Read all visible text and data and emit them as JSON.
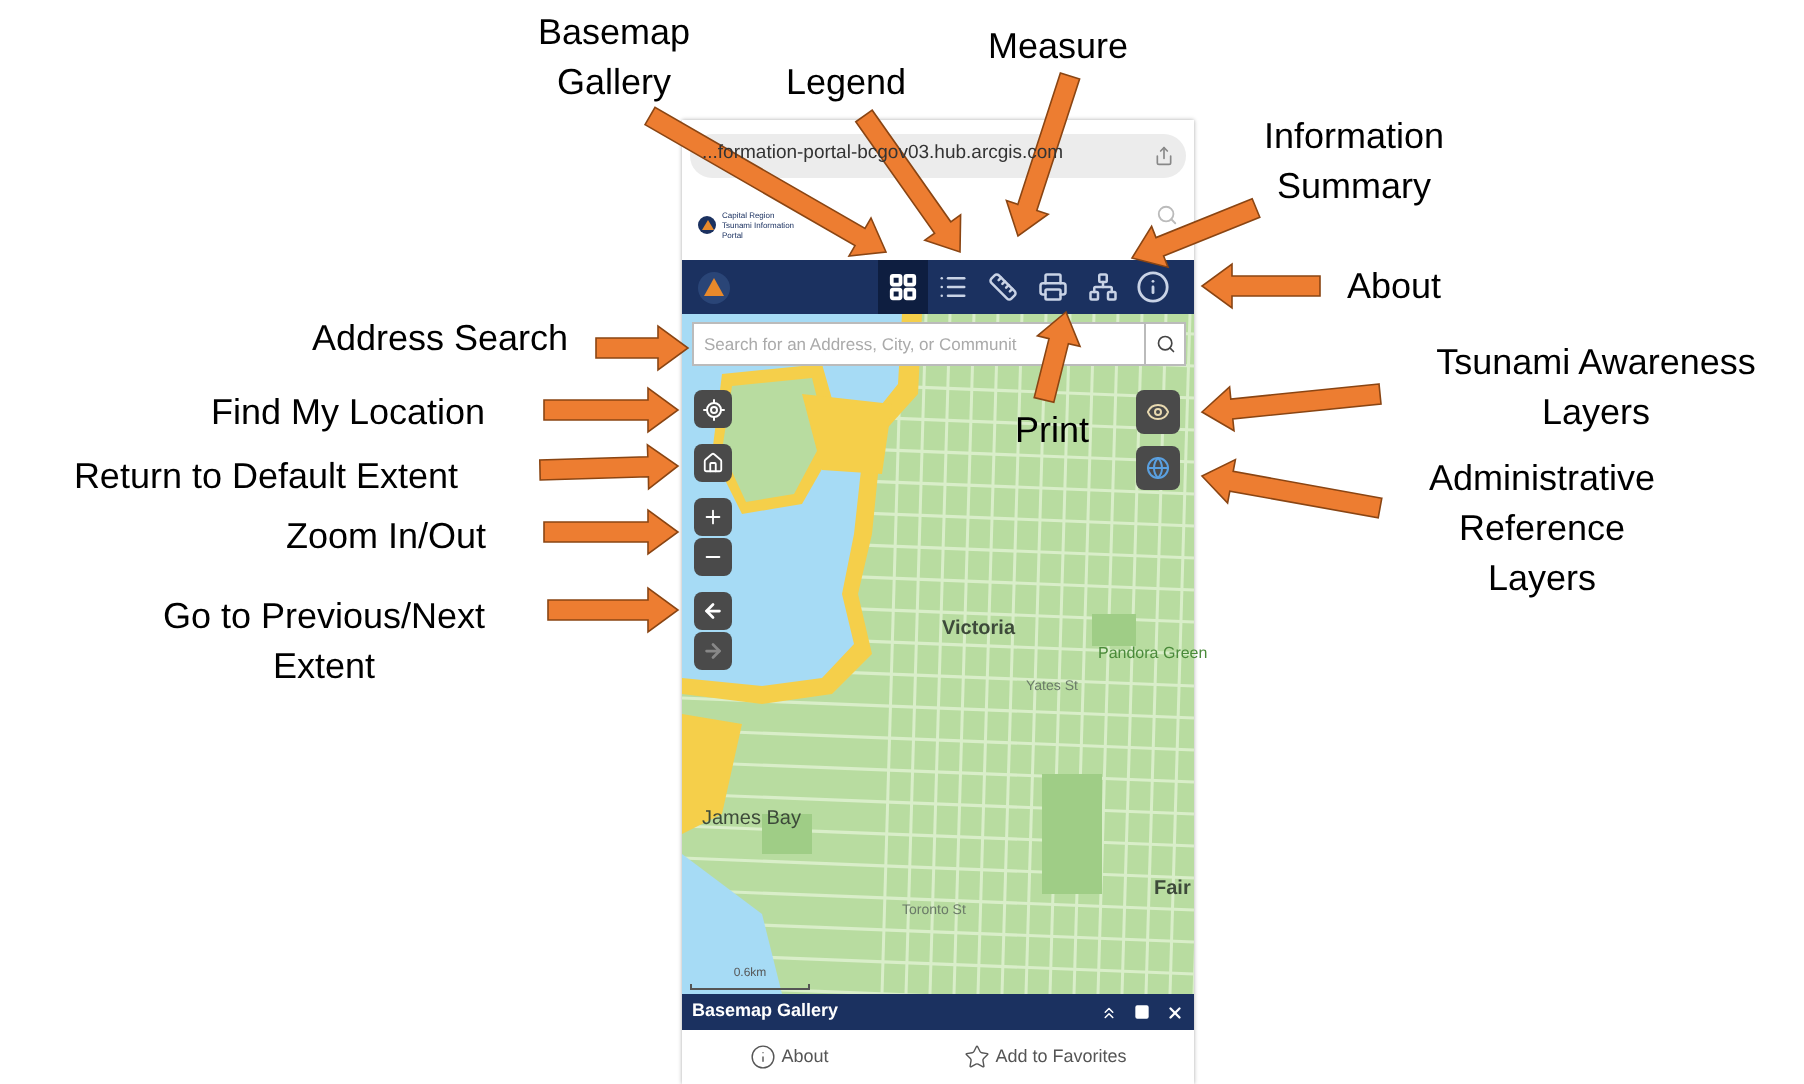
{
  "browser": {
    "url": "...formation-portal-bcgov03.hub.arcgis.com"
  },
  "header": {
    "title": "Capital Region Tsunami Information Portal"
  },
  "toolbar": {
    "tools": [
      {
        "kind": "grid",
        "selected": true
      },
      {
        "kind": "list",
        "selected": false
      },
      {
        "kind": "ruler",
        "selected": false
      },
      {
        "kind": "printer",
        "selected": false
      },
      {
        "kind": "network",
        "selected": false
      },
      {
        "kind": "info",
        "selected": false
      }
    ]
  },
  "search": {
    "placeholder": "Search for an Address, City, or Communit"
  },
  "map": {
    "labels": [
      {
        "text": "Victoria",
        "kind": "place"
      },
      {
        "text": "James Bay",
        "kind": "district"
      },
      {
        "text": "Pandora Green",
        "kind": "park"
      },
      {
        "text": "Fair",
        "kind": "place"
      },
      {
        "text": "Yates St",
        "kind": "street"
      },
      {
        "text": "Toronto St",
        "kind": "street"
      }
    ],
    "scale": "0.6km",
    "extent_buttons": [
      {
        "kind": "previous",
        "disabled": false
      },
      {
        "kind": "next",
        "disabled": true
      }
    ]
  },
  "panel": {
    "title": "Basemap Gallery",
    "actions": [
      {
        "label": "About",
        "kind": "info"
      },
      {
        "label": "Add to Favorites",
        "kind": "star"
      }
    ]
  },
  "annotations": [
    {
      "text": "Basemap\nGallery"
    },
    {
      "text": "Legend"
    },
    {
      "text": "Measure"
    },
    {
      "text": "Information\nSummary"
    },
    {
      "text": "About"
    },
    {
      "text": "Address Search"
    },
    {
      "text": "Print"
    },
    {
      "text": "Tsunami Awareness\nLayers"
    },
    {
      "text": "Administrative\nReference\nLayers"
    },
    {
      "text": "Find My Location"
    },
    {
      "text": "Return to Default Extent"
    },
    {
      "text": "Zoom In/Out"
    },
    {
      "text": "Go to Previous/Next\nExtent"
    }
  ]
}
